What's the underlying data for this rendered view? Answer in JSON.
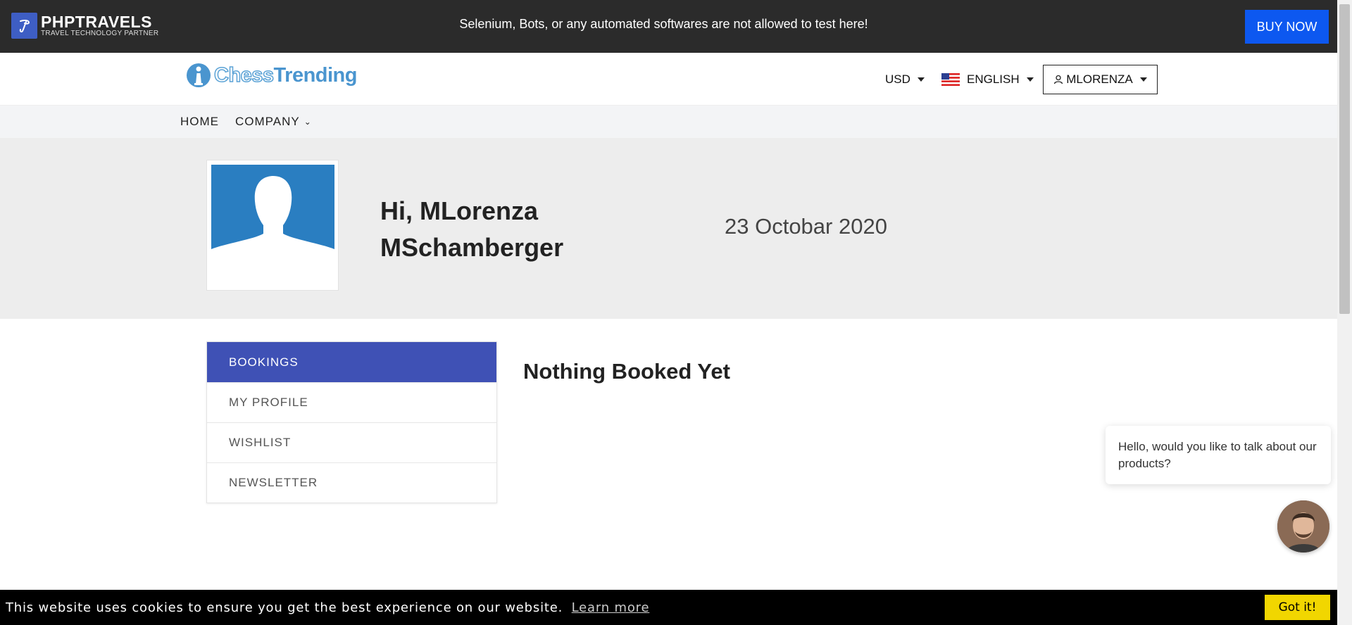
{
  "topbar": {
    "brand_name": "PHPTRAVELS",
    "brand_tagline": "TRAVEL TECHNOLOGY PARTNER",
    "notice": "Selenium, Bots, or any automated softwares are not allowed to test here!",
    "buy_label": "BUY NOW"
  },
  "header": {
    "logo_part1": "Chess",
    "logo_part2": "Trending",
    "currency": "USD",
    "language": "ENGLISH",
    "user": "MLORENZA"
  },
  "nav": {
    "home": "HOME",
    "company": "COMPANY"
  },
  "profile": {
    "greeting_line1": "Hi, MLorenza",
    "greeting_line2": "MSchamberger",
    "date": "23 Octobar 2020"
  },
  "sidebar": {
    "items": [
      {
        "label": "BOOKINGS"
      },
      {
        "label": "MY PROFILE"
      },
      {
        "label": "WISHLIST"
      },
      {
        "label": "NEWSLETTER"
      }
    ]
  },
  "main": {
    "empty_message": "Nothing Booked Yet"
  },
  "chat": {
    "message": "Hello, would you like to talk about our products?"
  },
  "cookie": {
    "message": "This website uses cookies to ensure you get the best experience on our website.",
    "learn_more": "Learn more",
    "accept": "Got it!"
  },
  "colors": {
    "topbar_bg": "#2b2b2b",
    "buy_button": "#0d58f0",
    "menu_active": "#3f51b5",
    "avatar_bg": "#2a7ec1",
    "cookie_button": "#f1d600"
  }
}
